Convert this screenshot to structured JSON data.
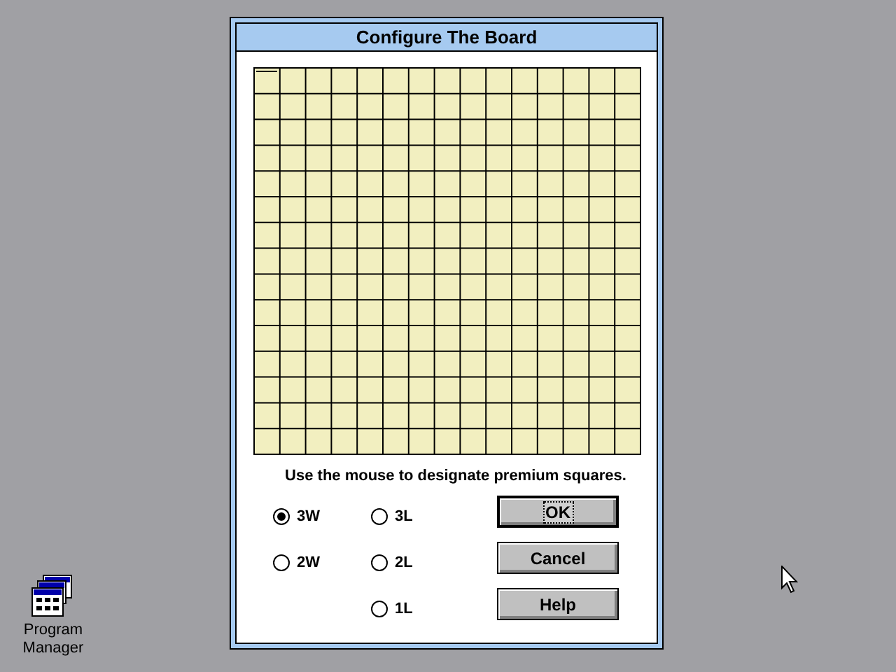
{
  "dialog": {
    "title": "Configure The Board",
    "instruction": "Use the mouse to designate premium squares.",
    "option_columns": [
      [
        {
          "label": "3W",
          "selected": true
        },
        {
          "label": "2W",
          "selected": false
        }
      ],
      [
        {
          "label": "3L",
          "selected": false
        },
        {
          "label": "2L",
          "selected": false
        },
        {
          "label": "1L",
          "selected": false
        }
      ]
    ],
    "buttons": [
      {
        "label": "OK",
        "focused": true
      },
      {
        "label": "Cancel",
        "focused": false
      },
      {
        "label": "Help",
        "focused": false
      }
    ]
  },
  "desktop_icons": [
    {
      "label": "Program Manager"
    }
  ]
}
